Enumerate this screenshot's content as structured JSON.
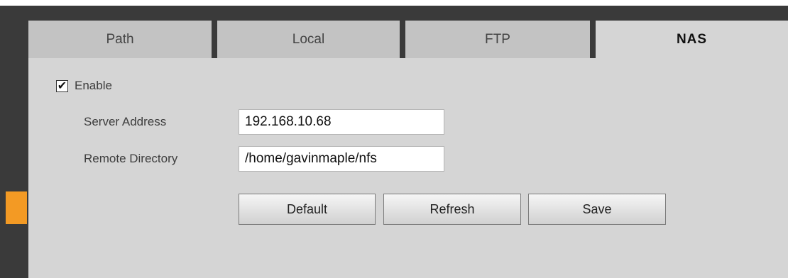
{
  "tabs": [
    {
      "label": "Path",
      "active": false
    },
    {
      "label": "Local",
      "active": false
    },
    {
      "label": "FTP",
      "active": false
    },
    {
      "label": "NAS",
      "active": true
    }
  ],
  "nas": {
    "enable": {
      "label": "Enable",
      "checked": true,
      "check_glyph": "✔"
    },
    "server_address": {
      "label": "Server Address",
      "value": "192.168.10.68"
    },
    "remote_directory": {
      "label": "Remote Directory",
      "value": "/home/gavinmaple/nfs"
    },
    "buttons": {
      "default_label": "Default",
      "refresh_label": "Refresh",
      "save_label": "Save"
    }
  },
  "colors": {
    "frame": "#3a3a3a",
    "panel": "#d5d5d5",
    "inactive_tab": "#c3c3c3",
    "accent": "#f39a24"
  }
}
